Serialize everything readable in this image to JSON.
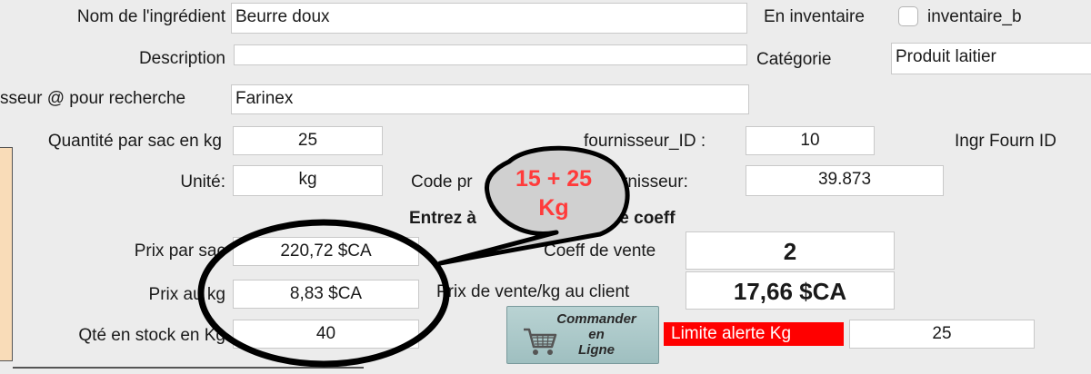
{
  "form": {
    "nom_label": "Nom de l'ingrédient",
    "nom_value": "Beurre doux",
    "description_label": "Description",
    "description_value": "",
    "fournisseur_label": "sseur @ pour recherche",
    "fournisseur_value": "Farinex",
    "quantite_label": "Quantité par sac en kg",
    "quantite_value": "25",
    "unite_label": "Unité:",
    "unite_value": "kg",
    "prix_sac_label": "Prix par sac",
    "prix_sac_value": "220,72 $CA",
    "prix_kg_label": "Prix au kg",
    "prix_kg_value": "8,83 $CA",
    "stock_label": "Qté en stock en Kg",
    "stock_value": "40",
    "inventaire_label": "En inventaire",
    "inventaire_checkbox_label": "inventaire_b",
    "categorie_label": "Catégorie",
    "categorie_value": "Produit laitier",
    "fournisseur_id_label": "fournisseur_ID :",
    "fournisseur_id_value": "10",
    "ingr_fourn_id_label": "Ingr Fourn ID",
    "code_label": "Code pr",
    "code_label_tail": "rnisseur:",
    "code_value": "39.873",
    "entrez_label": "Entrez à",
    "entrez_label_tail": "le coeff",
    "coeff_label": "Coeff de vente",
    "coeff_value": "2",
    "prix_vente_label": "Prix de vente/kg au client",
    "prix_vente_value": "17,66 $CA",
    "limite_label": "Limite alerte Kg",
    "limite_value": "25"
  },
  "order_button": {
    "line1": "Commander",
    "line2": "en",
    "line3": "Ligne",
    "icon": "shopping-cart-icon"
  },
  "annotation": {
    "line1": "15 + 25",
    "line2": "Kg",
    "color": "#ff3b3b"
  },
  "colors": {
    "alert": "#ff0000",
    "side_panel": "#f9dcb8",
    "button": "#a9c8c9"
  }
}
